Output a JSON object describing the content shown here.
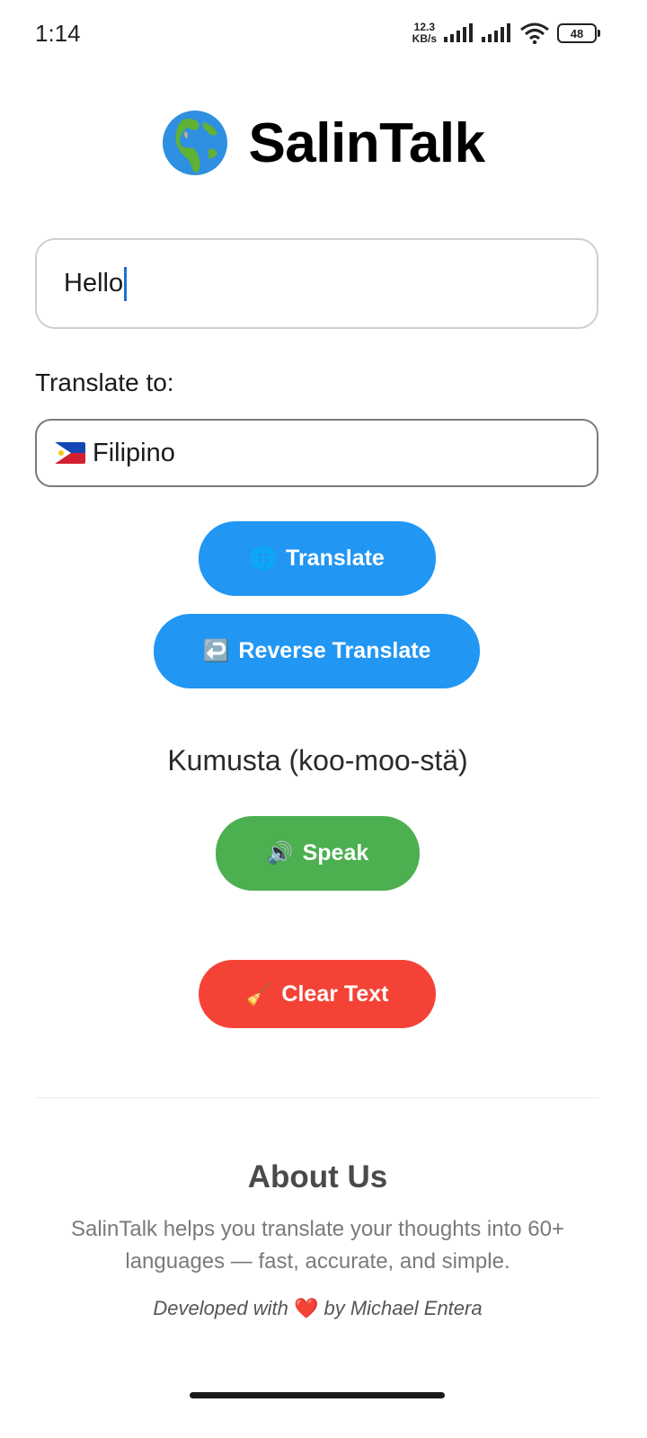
{
  "status": {
    "time": "1:14",
    "net_speed_value": "12.3",
    "net_speed_unit": "KB/s",
    "battery": "48"
  },
  "app": {
    "title": "SalinTalk",
    "title_icon": "globe-icon"
  },
  "input": {
    "value": "Hello"
  },
  "translate_to": {
    "label": "Translate to:",
    "selected_language": "Filipino",
    "flag_icon": "philippines-flag-icon"
  },
  "buttons": {
    "translate": "Translate",
    "reverse": "Reverse Translate",
    "speak": "Speak",
    "clear": "Clear Text"
  },
  "result": {
    "text": "Kumusta (koo-moo-stä)"
  },
  "about": {
    "title": "About Us",
    "body": "SalinTalk helps you translate your thoughts into 60+ languages — fast, accurate, and simple.",
    "credit_prefix": "Developed with",
    "credit_suffix": "by Michael Entera"
  },
  "colors": {
    "primary_blue": "#2196f3",
    "speak_green": "#4caf50",
    "clear_red": "#f44336"
  }
}
